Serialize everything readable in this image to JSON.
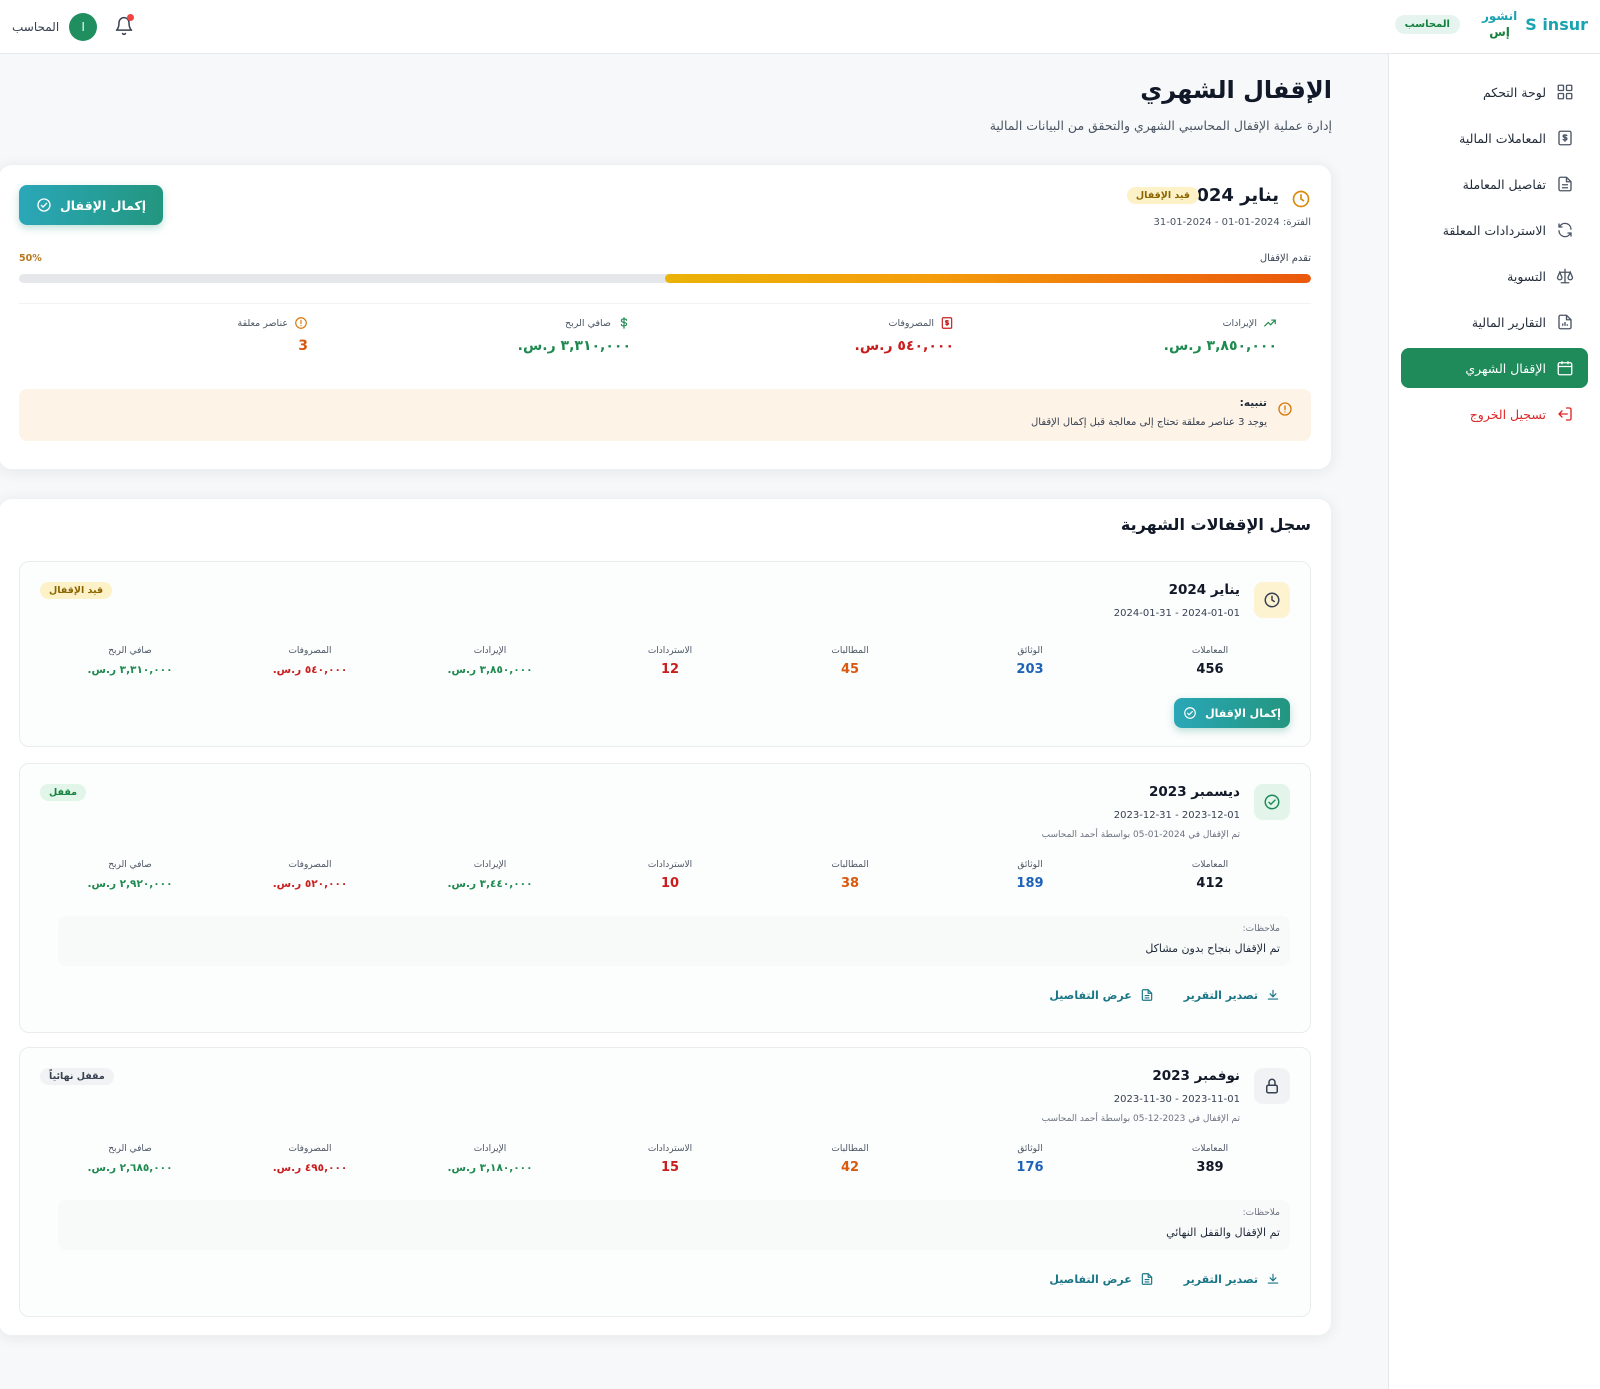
{
  "brand": {
    "latin": "S insur",
    "ar_line1": "انشور",
    "ar_line2": "إس",
    "role_chip": "المحاسب"
  },
  "user": {
    "name": "المحاسب",
    "avatar_letter": "ا"
  },
  "sidebar": {
    "items": [
      {
        "label": "لوحة التحكم",
        "icon": "dashboard-icon"
      },
      {
        "label": "المعاملات المالية",
        "icon": "dollar-document-icon"
      },
      {
        "label": "تفاصيل المعاملة",
        "icon": "document-icon"
      },
      {
        "label": "الاستردادات المعلقة",
        "icon": "refresh-icon"
      },
      {
        "label": "التسوية",
        "icon": "scale-icon"
      },
      {
        "label": "التقارير المالية",
        "icon": "report-icon"
      },
      {
        "label": "الإقفال الشهري",
        "icon": "calendar-icon",
        "active": true
      },
      {
        "label": "تسجيل الخروج",
        "icon": "logout-icon"
      }
    ]
  },
  "page": {
    "title": "الإقفال الشهري",
    "subtitle": "إدارة عملية الإقفال المحاسبي الشهري والتحقق من البيانات المالية"
  },
  "current": {
    "title": "يناير 2024",
    "badge": "قيد الإقفال",
    "period": "الفترة: 2024-01-01 - 2024-01-31",
    "complete_button": "إكمال الإقفال",
    "progress_label": "تقدم الإقفال",
    "progress_percent_text": "50%",
    "progress": 0.5,
    "stats": {
      "revenue": {
        "label": "الإيرادات",
        "value": "٣,٨٥٠,٠٠٠ ر.س."
      },
      "expenses": {
        "label": "المصروفات",
        "value": "٥٤٠,٠٠٠ ر.س."
      },
      "profit": {
        "label": "صافي الربح",
        "value": "٣,٣١٠,٠٠٠ ر.س."
      },
      "pending": {
        "label": "عناصر معلقة",
        "value": "3"
      }
    },
    "alert": {
      "title": "تنبيه:",
      "text": "يوجد 3 عناصر معلقة تحتاج إلى معالجة قبل إكمال الإقفال"
    }
  },
  "history": {
    "title": "سجل الإقفالات الشهرية",
    "labels": {
      "transactions": "المعاملات",
      "documents": "الوثائق",
      "claims": "المطالبات",
      "refunds": "الاستردادات",
      "revenue": "الإيرادات",
      "expenses": "المصروفات",
      "profit": "صافي الربح",
      "notes": "ملاحظات:",
      "export": "تصدير التقرير",
      "details": "عرض التفاصيل",
      "complete": "إكمال الإقفال"
    },
    "entries": [
      {
        "title": "يناير 2024",
        "dates": "2024-01-01 - 2024-01-31",
        "badge": "قيد الإقفال",
        "transactions": "456",
        "documents": "203",
        "claims": "45",
        "refunds": "12",
        "revenue": "٣,٨٥٠,٠٠٠ ر.س.",
        "expenses": "٥٤٠,٠٠٠ ر.س.",
        "profit": "٣,٣١٠,٠٠٠ ر.س."
      },
      {
        "title": "ديسمبر 2023",
        "dates": "2023-12-01 - 2023-12-31",
        "closed_by": "تم الإقفال في 2024-01-05 بواسطة أحمد المحاسب",
        "badge": "مقفل",
        "transactions": "412",
        "documents": "189",
        "claims": "38",
        "refunds": "10",
        "revenue": "٣,٤٤٠,٠٠٠ ر.س.",
        "expenses": "٥٢٠,٠٠٠ ر.س.",
        "profit": "٢,٩٢٠,٠٠٠ ر.س.",
        "notes": "تم الإقفال بنجاح بدون مشاكل"
      },
      {
        "title": "نوفمبر 2023",
        "dates": "2023-11-01 - 2023-11-30",
        "closed_by": "تم الإقفال في 2023-12-05 بواسطة أحمد المحاسب",
        "badge": "مقفل نهائياً",
        "transactions": "389",
        "documents": "176",
        "claims": "42",
        "refunds": "15",
        "revenue": "٣,١٨٠,٠٠٠ ر.س.",
        "expenses": "٤٩٥,٠٠٠ ر.س.",
        "profit": "٢,٦٨٥,٠٠٠ ر.س.",
        "notes": "تم الإقفال والقفل النهائي"
      }
    ]
  },
  "colors": {
    "primary": "#1f8a5a",
    "accent": "#1aa3b0",
    "revenue": "#1e8a4f",
    "expenses": "#c81e1e",
    "warning": "#d97706",
    "documents": "#1e63b8",
    "claims": "#d9590f"
  }
}
